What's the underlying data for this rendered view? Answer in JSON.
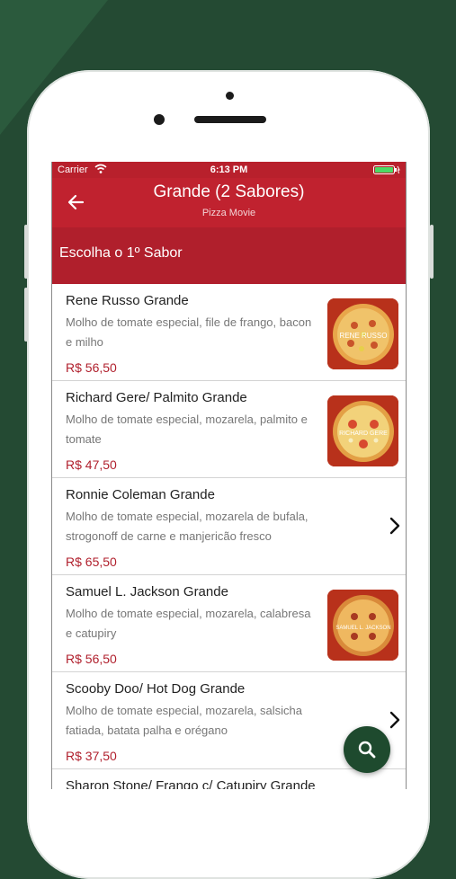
{
  "status": {
    "carrier": "Carrier",
    "time": "6:13 PM"
  },
  "nav": {
    "title": "Grande (2 Sabores)",
    "subtitle": "Pizza Movie"
  },
  "section": {
    "title": "Escolha o 1º Sabor"
  },
  "items": [
    {
      "name": "Rene Russo Grande",
      "desc": "Molho de tomate especial, file de frango, bacon e milho",
      "price": "R$ 56,50",
      "thumb": "RENE RUSSO"
    },
    {
      "name": "Richard Gere/ Palmito Grande",
      "desc": "Molho de tomate especial, mozarela, palmito e tomate",
      "price": "R$ 47,50",
      "thumb": "RICHARD GERE"
    },
    {
      "name": "Ronnie Coleman Grande",
      "desc": "Molho de tomate especial, mozarela de bufala, strogonoff de carne e manjericão fresco",
      "price": "R$ 65,50"
    },
    {
      "name": "Samuel L. Jackson Grande",
      "desc": "Molho de tomate especial, mozarela, calabresa e catupiry",
      "price": "R$ 56,50",
      "thumb": "SAMUEL L. JACKSON"
    },
    {
      "name": "Scooby Doo/ Hot Dog Grande",
      "desc": "Molho de tomate especial, mozarela, salsicha fatiada, batata palha e orégano",
      "price": "R$ 37,50"
    },
    {
      "name": "Sharon Stone/ Frango c/ Catupiry Grande",
      "desc": "",
      "price": ""
    }
  ],
  "colors": {
    "accent": "#c0222f",
    "section": "#b01f2c",
    "fab": "#1e4a2e",
    "background": "#244a33"
  },
  "icons": {
    "back": "arrow-left-icon",
    "search": "search-icon",
    "chevron": "chevron-right-icon"
  }
}
